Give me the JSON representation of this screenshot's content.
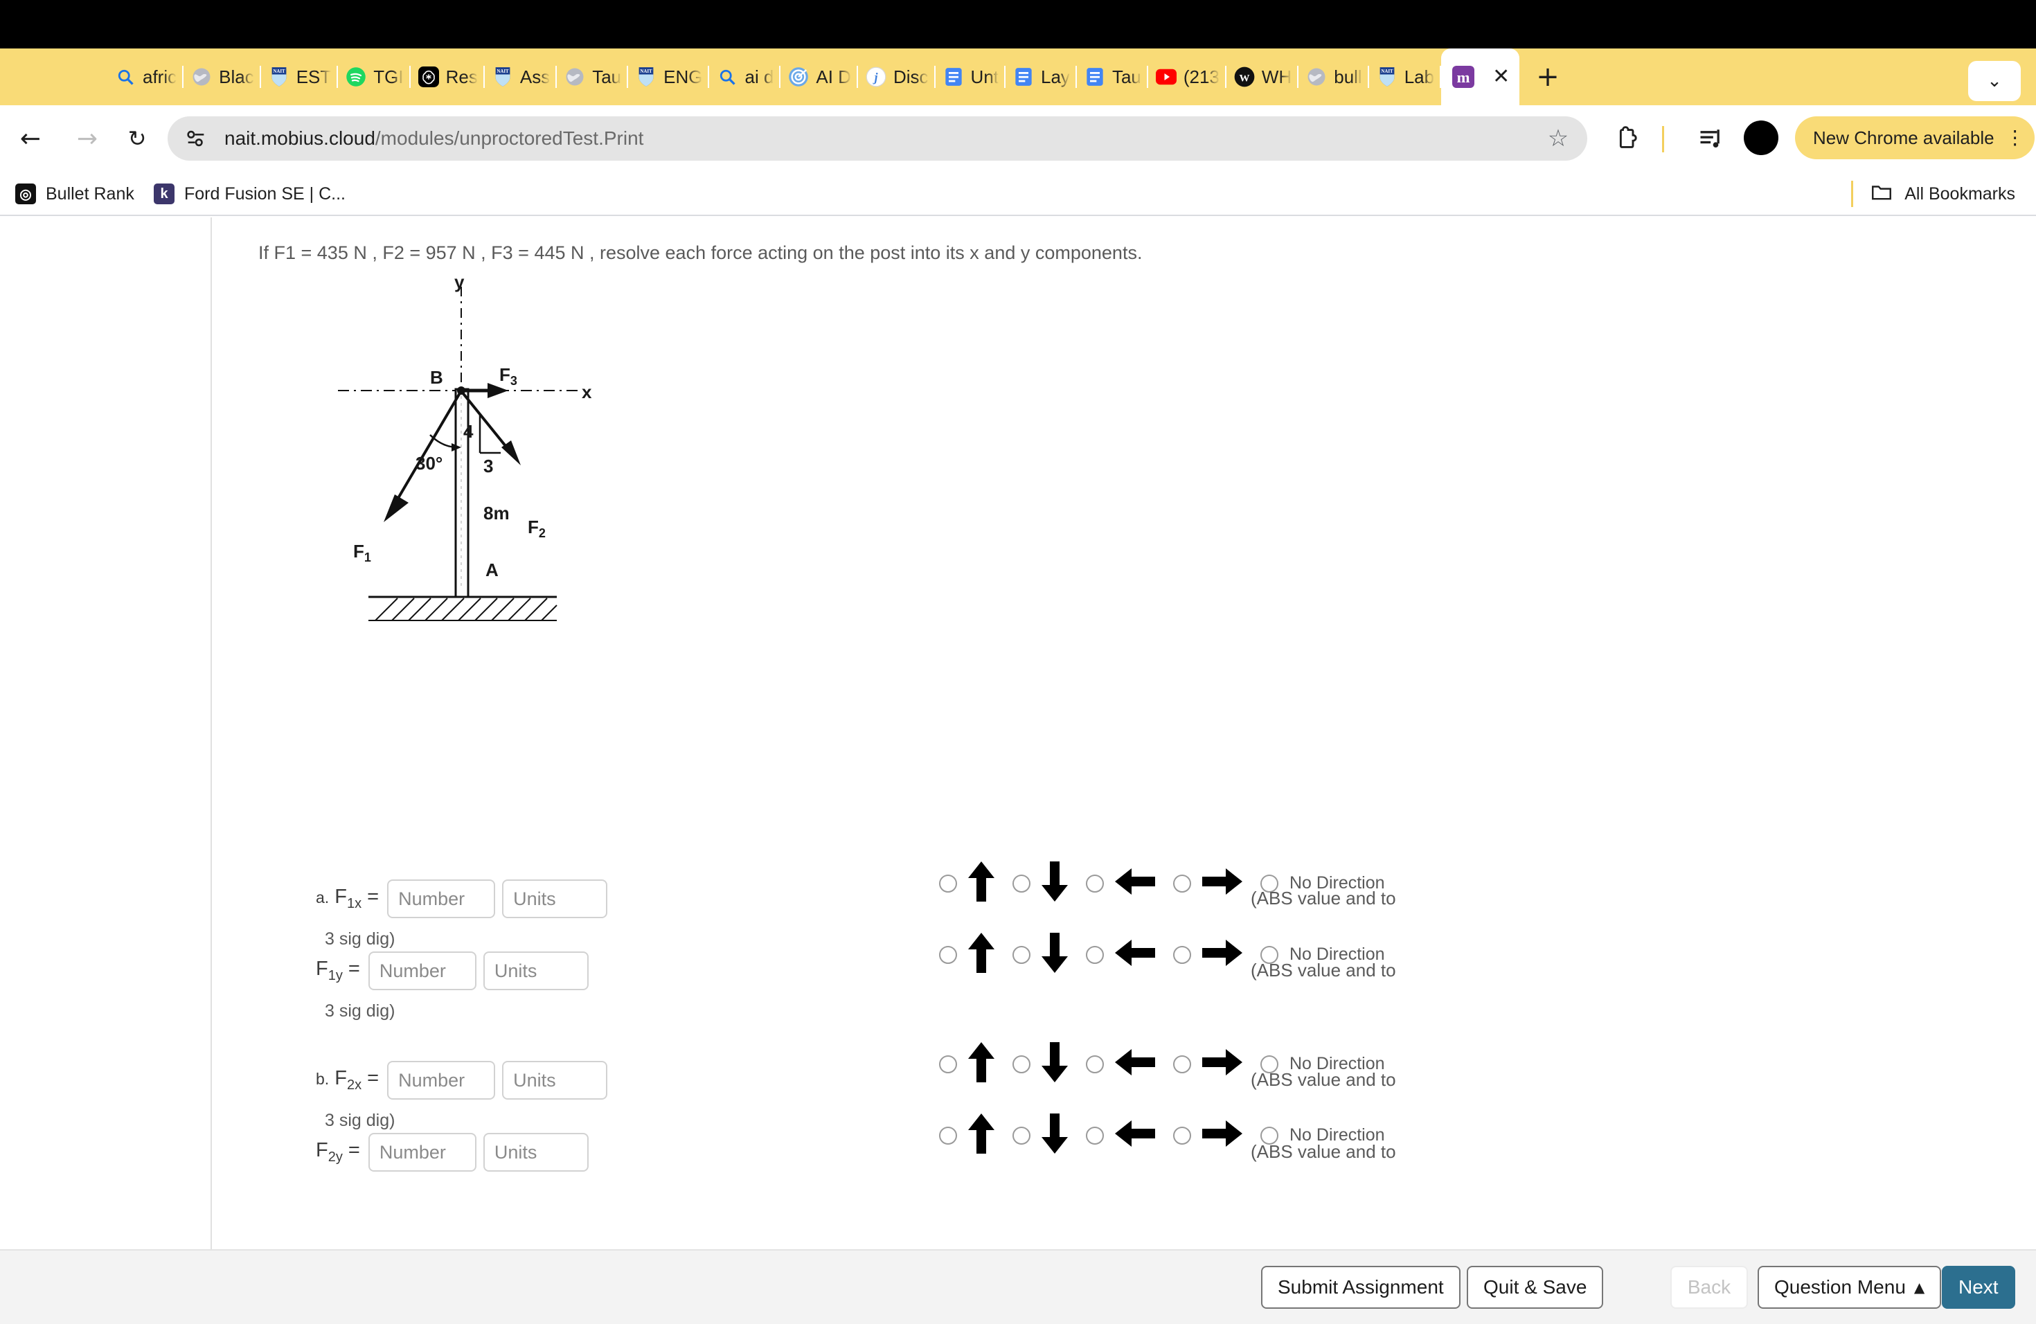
{
  "browser": {
    "tabs": [
      {
        "label": "afric",
        "icon": "search-icon"
      },
      {
        "label": "Blac",
        "icon": "globe-icon"
      },
      {
        "label": "EST",
        "icon": "nait-shield-icon"
      },
      {
        "label": "TGI",
        "icon": "spotify-icon"
      },
      {
        "label": "Res",
        "icon": "openai-icon"
      },
      {
        "label": "Ass",
        "icon": "nait-shield-icon"
      },
      {
        "label": "Tau",
        "icon": "globe-icon"
      },
      {
        "label": "ENG",
        "icon": "nait-shield-icon"
      },
      {
        "label": "ai d",
        "icon": "search-icon"
      },
      {
        "label": "AI D",
        "icon": "target-icon"
      },
      {
        "label": "Disc",
        "icon": "j-icon"
      },
      {
        "label": "Unt",
        "icon": "google-docs-icon"
      },
      {
        "label": "Lay",
        "icon": "google-docs-icon"
      },
      {
        "label": "Tau",
        "icon": "google-docs-icon"
      },
      {
        "label": "(213",
        "icon": "youtube-icon"
      },
      {
        "label": "WH",
        "icon": "w-circle-icon"
      },
      {
        "label": "bull",
        "icon": "globe-icon"
      },
      {
        "label": "Lab",
        "icon": "nait-shield-icon"
      }
    ],
    "active_tab": {
      "label": "",
      "icon": "mobius-m-icon",
      "close": "✕"
    },
    "new_tab": "+",
    "tab_list_caret": "⌄",
    "nav": {
      "back": "←",
      "forward": "→",
      "reload": "↻"
    },
    "url": {
      "prefix": "nait.mobius.cloud",
      "rest": "/modules/unproctoredTest.Print"
    },
    "star": "☆",
    "chrome_update": {
      "label": "New Chrome available",
      "menu": "⋮"
    },
    "bookmarks": [
      {
        "label": "Bullet Rank",
        "icon": "bullet-rank-icon",
        "glyph": "◎"
      },
      {
        "label": "Ford Fusion SE | C...",
        "icon": "kijiji-icon",
        "glyph": "k"
      }
    ],
    "all_bookmarks": "All Bookmarks"
  },
  "question": {
    "text": "If F1 = 435 N , F2 = 957 N , F3 = 445 N , resolve each force acting on the post into its x and y components."
  },
  "figure": {
    "axis_y": "y",
    "axis_x": "x",
    "point_b": "B",
    "point_a": "A",
    "f1": "F",
    "f1sub": "1",
    "f2": "F",
    "f2sub": "2",
    "f3": "F",
    "f3sub": "3",
    "angle": "30°",
    "slope_rise": "4",
    "slope_run": "3",
    "length": "8m"
  },
  "direction_options": {
    "up": "arrow-up",
    "down": "arrow-down",
    "left": "arrow-left",
    "right": "arrow-right",
    "none_label": "No Direction"
  },
  "answers": [
    {
      "prefix": "a.",
      "label": "F",
      "sub": "1x",
      "number_placeholder": "Number",
      "units_placeholder": "Units",
      "sigdig": "3 sig dig)",
      "abs_note": "(ABS value and to"
    },
    {
      "prefix": "",
      "label": "F",
      "sub": "1y",
      "number_placeholder": "Number",
      "units_placeholder": "Units",
      "sigdig": "3 sig dig)",
      "abs_note": "(ABS value and to"
    },
    {
      "prefix": "b.",
      "label": "F",
      "sub": "2x",
      "number_placeholder": "Number",
      "units_placeholder": "Units",
      "sigdig": "3 sig dig)",
      "abs_note": "(ABS value and to"
    },
    {
      "prefix": "",
      "label": "F",
      "sub": "2y",
      "number_placeholder": "Number",
      "units_placeholder": "Units",
      "sigdig": "",
      "abs_note": "(ABS value and to"
    }
  ],
  "toolbar": {
    "submit": "Submit Assignment",
    "quit": "Quit & Save",
    "back": "Back",
    "question_menu": "Question Menu",
    "question_menu_caret": "▲",
    "next": "Next"
  },
  "colors": {
    "tabstrip": "#f9db77",
    "next_button": "#2c6f8f",
    "mobius_purple": "#7b3aa0"
  }
}
